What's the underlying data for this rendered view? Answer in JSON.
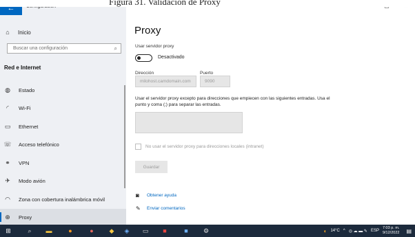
{
  "caption": {
    "text": "Figura 31. Validación de Proxy"
  },
  "window": {
    "title": "Configuración",
    "minimize": "–",
    "maximize": "▢",
    "close": "×"
  },
  "sidebar": {
    "back": "←",
    "home": {
      "label": "Inicio",
      "icon": "home-icon"
    },
    "search": {
      "placeholder": "Buscar una configuración",
      "icon": "search-icon"
    },
    "section_title": "Red e Internet",
    "items": [
      {
        "label": "Estado",
        "icon": "globe-icon"
      },
      {
        "label": "Wi-Fi",
        "icon": "wifi-icon"
      },
      {
        "label": "Ethernet",
        "icon": "ethernet-icon"
      },
      {
        "label": "Acceso telefónico",
        "icon": "dialup-icon"
      },
      {
        "label": "VPN",
        "icon": "vpn-icon"
      },
      {
        "label": "Modo avión",
        "icon": "airplane-icon"
      },
      {
        "label": "Zona con cobertura inalámbrica móvil",
        "icon": "hotspot-icon"
      },
      {
        "label": "Proxy",
        "icon": "proxy-globe-icon",
        "active": true
      }
    ]
  },
  "main": {
    "title": "Proxy",
    "use_proxy_label": "Usar servidor proxy",
    "toggle_state": "Desactivado",
    "address_label": "Dirección",
    "address_value": "milohost.camdomain.com",
    "port_label": "Puerto",
    "port_value": "9090",
    "exceptions_desc": "Usar el servidor proxy excepto para direcciones que empiecen con las siguientes entradas. Usa el punto y coma (;) para separar las entradas.",
    "exceptions_value": "",
    "local_checkbox_label": "No usar el servidor proxy para direcciones locales (intranet)",
    "save_label": "Guardar",
    "help_link": "Obtener ayuda",
    "feedback_link": "Enviar comentarios"
  },
  "taskbar": {
    "temperature": "14°C",
    "language": "ESP",
    "time": "7:03 p. m.",
    "date": "9/12/2022"
  },
  "colors": {
    "accent": "#0067c0",
    "taskbar": "#1c2a3c",
    "sidebar": "#eef0f4"
  }
}
